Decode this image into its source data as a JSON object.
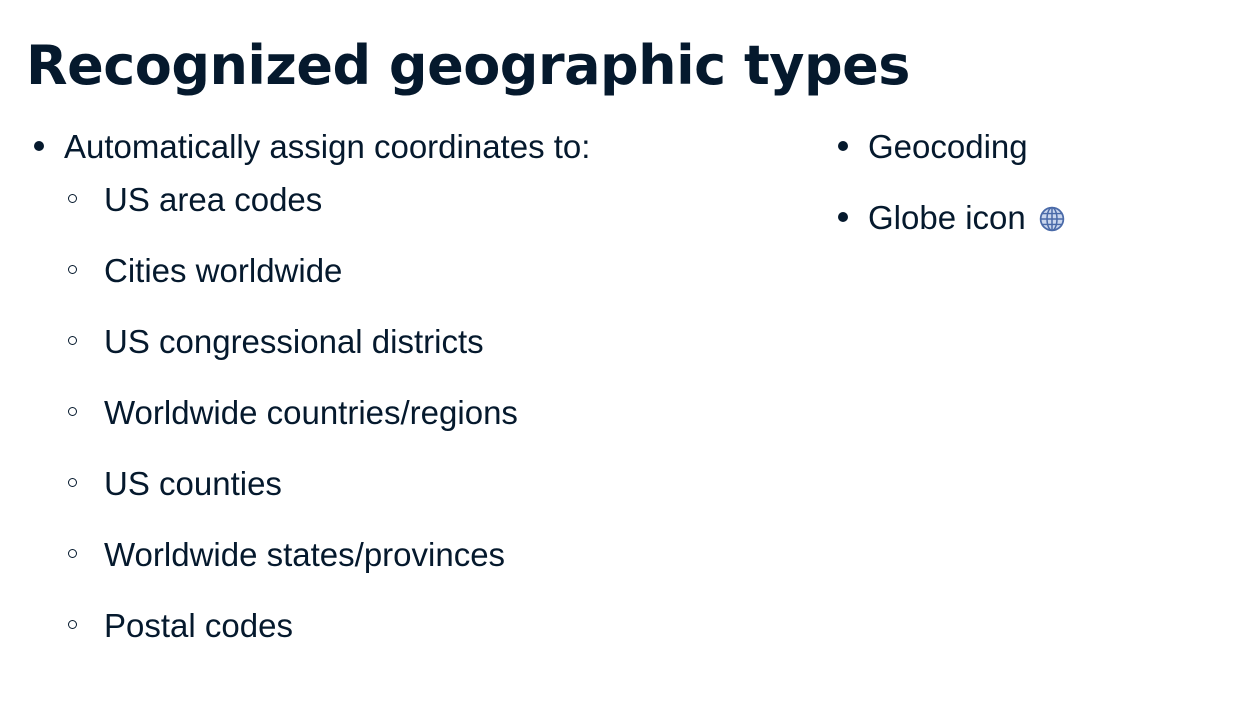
{
  "title": "Recognized geographic types",
  "left_column": {
    "bullet": "Automatically assign coordinates to:",
    "sub_items": [
      "US area codes",
      "Cities worldwide",
      "US congressional districts",
      "Worldwide countries/regions",
      "US counties",
      "Worldwide states/provinces",
      "Postal codes"
    ]
  },
  "right_column": {
    "items": [
      "Geocoding",
      "Globe icon"
    ],
    "icon": "globe-icon"
  },
  "colors": {
    "text": "#05192d",
    "globe_fill": "#c9d6ee",
    "globe_stroke": "#4a6aa8"
  }
}
